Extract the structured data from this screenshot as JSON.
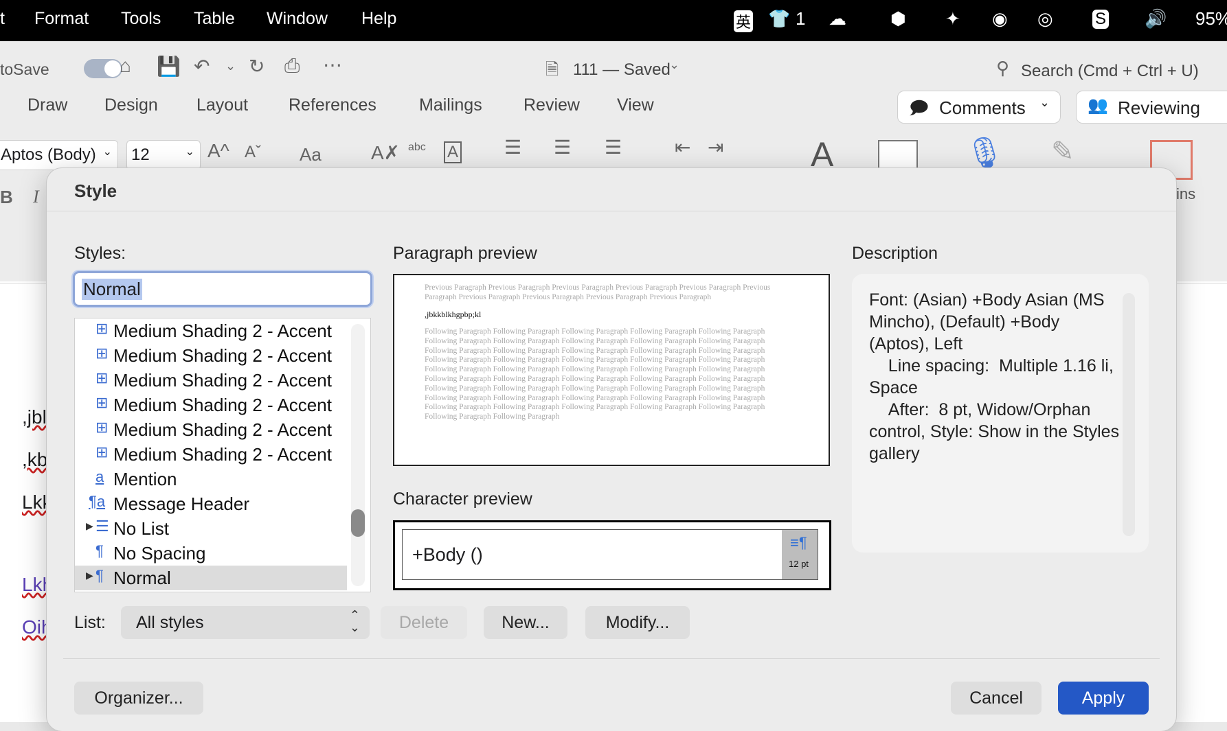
{
  "menubar": {
    "items": [
      "t",
      "Format",
      "Tools",
      "Table",
      "Window",
      "Help"
    ],
    "status": {
      "ime": "英",
      "shirt_count": "1",
      "battery": "95%"
    }
  },
  "toolbar": {
    "autosave": "toSave",
    "doc_title": "111 — Saved",
    "search": "Search (Cmd + Ctrl + U)",
    "tabs": [
      "Draw",
      "Design",
      "Layout",
      "References",
      "Mailings",
      "Review",
      "View"
    ],
    "comments": "Comments",
    "reviewing": "Reviewing",
    "font": "Aptos (Body)",
    "size": "12",
    "bold": "B",
    "italic": "I",
    "font_grow": "A^",
    "font_shrink": "Aˇ",
    "case": "Aa",
    "abc": "abc",
    "add_ins": "ins"
  },
  "doc_fragments": [
    ",jbl",
    ",kb",
    "Lkk",
    "Lkh",
    "Oih"
  ],
  "dialog": {
    "title": "Style",
    "styles_label": "Styles:",
    "style_name": "Normal",
    "styles": [
      {
        "icon": "⊞",
        "name": "Medium Shading 2 - Accent"
      },
      {
        "icon": "⊞",
        "name": "Medium Shading 2 - Accent"
      },
      {
        "icon": "⊞",
        "name": "Medium Shading 2 - Accent"
      },
      {
        "icon": "⊞",
        "name": "Medium Shading 2 - Accent"
      },
      {
        "icon": "⊞",
        "name": "Medium Shading 2 - Accent"
      },
      {
        "icon": "⊞",
        "name": "Medium Shading 2 - Accent"
      },
      {
        "icon": "a",
        "name": "Mention"
      },
      {
        "icon": "¶a",
        "name": "Message Header"
      },
      {
        "icon": "☰",
        "name": "No List"
      },
      {
        "icon": "¶",
        "name": "No Spacing"
      },
      {
        "icon": "¶",
        "name": "Normal"
      }
    ],
    "paragraph_preview_label": "Paragraph preview",
    "preview_previous": "Previous Paragraph Previous Paragraph Previous Paragraph Previous Paragraph Previous Paragraph Previous Paragraph Previous Paragraph Previous Paragraph Previous Paragraph Previous Paragraph",
    "preview_sample": ",jbkkblkhgpbp;kl",
    "preview_following": "Following Paragraph Following Paragraph Following Paragraph Following Paragraph Following Paragraph Following Paragraph Following Paragraph Following Paragraph Following Paragraph Following Paragraph Following Paragraph Following Paragraph Following Paragraph Following Paragraph Following Paragraph Following Paragraph Following Paragraph Following Paragraph Following Paragraph Following Paragraph Following Paragraph Following Paragraph Following Paragraph Following Paragraph Following Paragraph Following Paragraph Following Paragraph Following Paragraph Following Paragraph Following Paragraph Following Paragraph Following Paragraph Following Paragraph Following Paragraph Following Paragraph Following Paragraph Following Paragraph Following Paragraph Following Paragraph Following Paragraph Following Paragraph Following Paragraph Following Paragraph Following Paragraph Following Paragraph Following Paragraph Following Paragraph",
    "character_preview_label": "Character preview",
    "character_preview": "+Body ()",
    "char_size": "12 pt",
    "description_label": "Description",
    "description": "Font: (Asian) +Body Asian (MS Mincho), (Default) +Body (Aptos), Left\n    Line spacing:  Multiple 1.16 li, Space\n    After:  8 pt, Widow/Orphan control, Style: Show in the Styles gallery",
    "list_label": "List:",
    "list_value": "All styles",
    "delete": "Delete",
    "new": "New...",
    "modify": "Modify...",
    "organizer": "Organizer...",
    "cancel": "Cancel",
    "apply": "Apply"
  }
}
